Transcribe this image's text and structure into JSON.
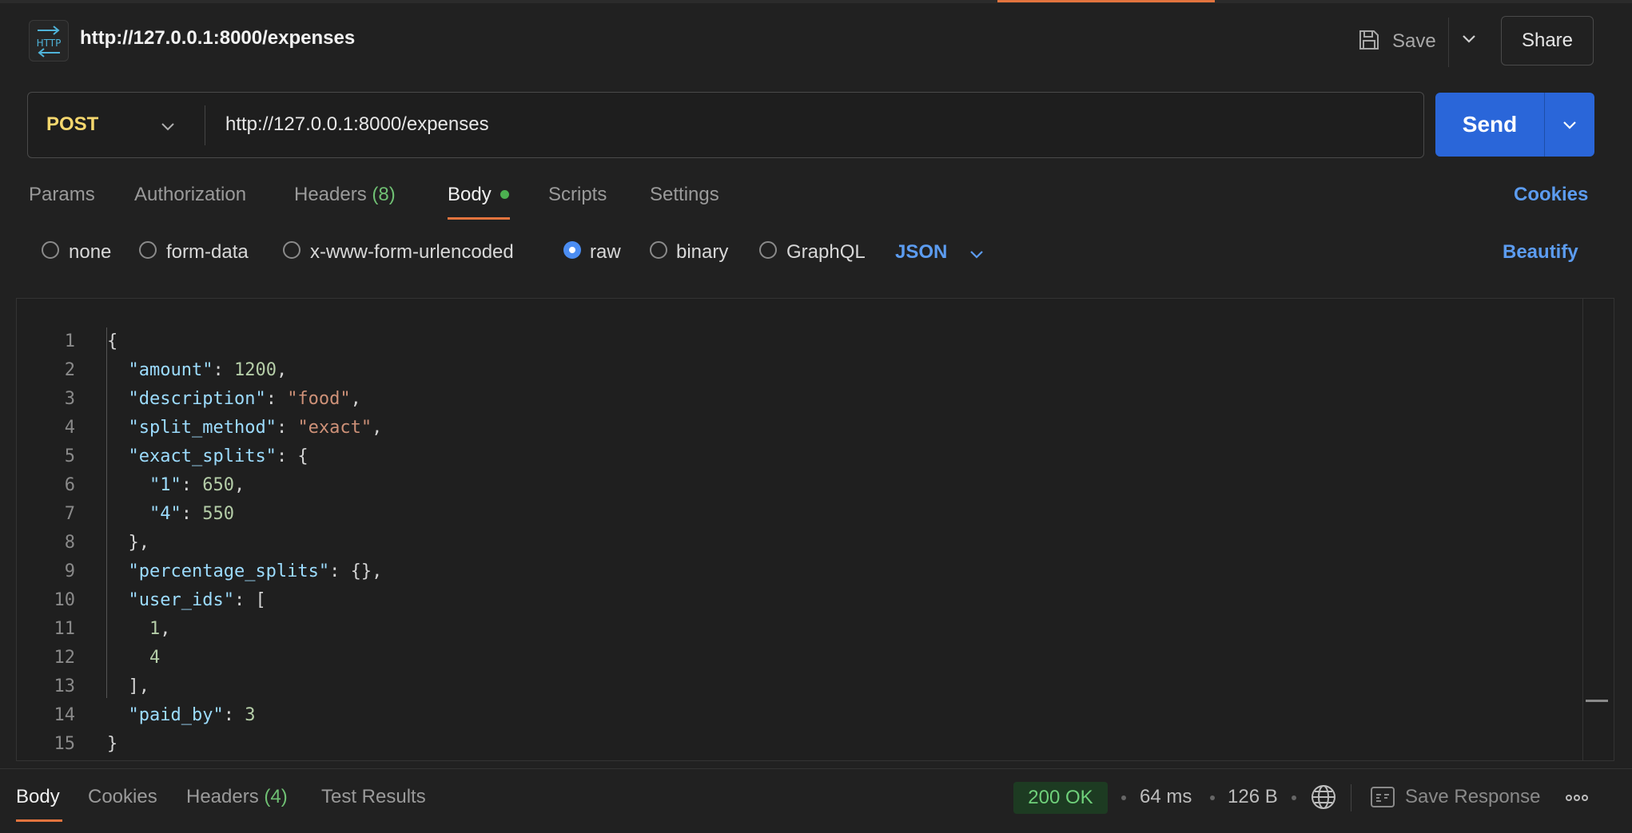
{
  "header": {
    "title": "http://127.0.0.1:8000/expenses",
    "save_label": "Save",
    "share_label": "Share",
    "http_icon_text": "HTTP"
  },
  "request": {
    "method": "POST",
    "url": "http://127.0.0.1:8000/expenses",
    "send_label": "Send"
  },
  "tabs": {
    "params": "Params",
    "authorization": "Authorization",
    "headers": "Headers",
    "headers_count": "(8)",
    "body": "Body",
    "scripts": "Scripts",
    "settings": "Settings",
    "cookies": "Cookies"
  },
  "body_modes": {
    "none": "none",
    "form_data": "form-data",
    "urlencoded": "x-www-form-urlencoded",
    "raw": "raw",
    "binary": "binary",
    "graphql": "GraphQL",
    "selected": "raw",
    "format": "JSON",
    "beautify": "Beautify"
  },
  "editor": {
    "line_numbers": [
      "1",
      "2",
      "3",
      "4",
      "5",
      "6",
      "7",
      "8",
      "9",
      "10",
      "11",
      "12",
      "13",
      "14",
      "15"
    ]
  },
  "response": {
    "tabs": {
      "body": "Body",
      "cookies": "Cookies",
      "headers": "Headers",
      "headers_count": "(4)",
      "test_results": "Test Results"
    },
    "status": "200 OK",
    "time": "64 ms",
    "size": "126 B",
    "save_response": "Save Response"
  },
  "colors": {
    "accent": "#e3743e",
    "send": "#2a66d9",
    "link": "#5c9cf0",
    "method": "#f5d76e",
    "status_ok": "#6fd07a"
  }
}
